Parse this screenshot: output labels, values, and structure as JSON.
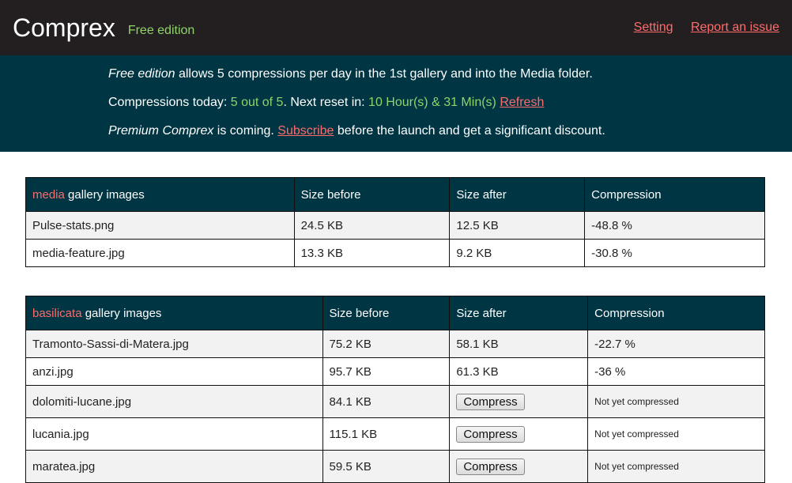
{
  "header": {
    "title": "Comprex",
    "edition": "Free edition",
    "links": {
      "setting": "Setting",
      "report": "Report an issue"
    }
  },
  "info": {
    "line1_em": "Free edition",
    "line1_rest": " allows 5 compressions per day in the 1st gallery and into the Media folder.",
    "line2_label": "Compressions today: ",
    "line2_count": "5 out of 5",
    "line2_mid": ". Next reset in: ",
    "line2_reset": "10 Hour(s) & 31 Min(s)",
    "line2_refresh": "Refresh",
    "line3_em": "Premium Comprex",
    "line3_mid": " is coming. ",
    "line3_link": "Subscribe",
    "line3_rest": " before the launch and get a significant discount."
  },
  "tables": {
    "media": {
      "gallery": "media",
      "header_suffix": " gallery images",
      "col_before": "Size before",
      "col_after": "Size after",
      "col_compression": "Compression",
      "rows": [
        {
          "name": "Pulse-stats.png",
          "before": "24.5 KB",
          "after": "12.5 KB",
          "compression": "-48.8 %"
        },
        {
          "name": "media-feature.jpg",
          "before": "13.3 KB",
          "after": "9.2 KB",
          "compression": "-30.8 %"
        }
      ]
    },
    "basilicata": {
      "gallery": "basilicata",
      "header_suffix": " gallery images",
      "col_before": "Size before",
      "col_after": "Size after",
      "col_compression": "Compression",
      "rows": [
        {
          "name": "Tramonto-Sassi-di-Matera.jpg",
          "before": "75.2 KB",
          "after": "58.1 KB",
          "compression": "-22.7 %"
        },
        {
          "name": "anzi.jpg",
          "before": "95.7 KB",
          "after": "61.3 KB",
          "compression": "-36 %"
        },
        {
          "name": "dolomiti-lucane.jpg",
          "before": "84.1 KB",
          "button": "Compress",
          "status": "Not yet compressed"
        },
        {
          "name": "lucania.jpg",
          "before": "115.1 KB",
          "button": "Compress",
          "status": "Not yet compressed"
        },
        {
          "name": "maratea.jpg",
          "before": "59.5 KB",
          "button": "Compress",
          "status": "Not yet compressed"
        }
      ]
    }
  }
}
